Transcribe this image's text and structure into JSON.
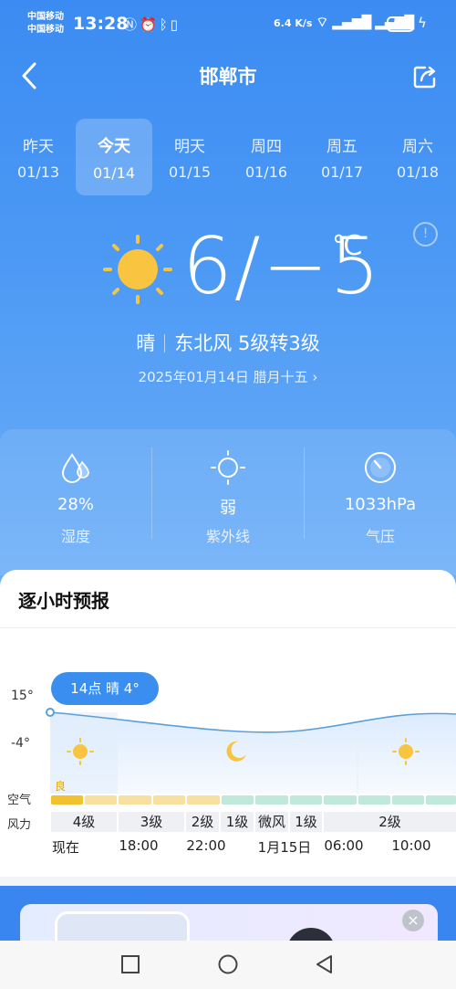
{
  "status": {
    "carrier1": "中国移动",
    "carrier2": "中国移动",
    "time": "13:28",
    "net_speed": "6.4 K/s",
    "battery": "26"
  },
  "header": {
    "city": "邯郸市"
  },
  "days": [
    {
      "name": "昨天",
      "date": "01/13"
    },
    {
      "name": "今天",
      "date": "01/14"
    },
    {
      "name": "明天",
      "date": "01/15"
    },
    {
      "name": "周四",
      "date": "01/16"
    },
    {
      "name": "周五",
      "date": "01/17"
    },
    {
      "name": "周六",
      "date": "01/18"
    }
  ],
  "current": {
    "temp": "6/−5",
    "unit": "℃",
    "weather": "晴",
    "wind": "东北风 5级转3级",
    "date": "2025年01月14日 腊月十五 ›",
    "icon": "sun-icon"
  },
  "metrics": [
    {
      "value": "28%",
      "label": "湿度",
      "icon": "humidity-icon"
    },
    {
      "value": "弱",
      "label": "紫外线",
      "icon": "uv-icon"
    },
    {
      "value": "1033hPa",
      "label": "气压",
      "icon": "pressure-icon"
    }
  ],
  "hourly": {
    "title": "逐小时预报",
    "y_high": "15°",
    "y_low": "-4°",
    "bubble": "14点 晴 4°",
    "air_label": "空气",
    "wind_label": "风力",
    "air_quality": "良",
    "wind": [
      "4级",
      "3级",
      "2级",
      "1级",
      "微风",
      "1级",
      "2级"
    ],
    "times": [
      "现在",
      "18:00",
      "22:00",
      "1月15日",
      "06:00",
      "10:00"
    ]
  },
  "colors": {
    "accent": "#3a8ef0",
    "sun": "#f9c440",
    "air_good": "#f5d36a",
    "air_excellent": "#a9e4cf"
  }
}
